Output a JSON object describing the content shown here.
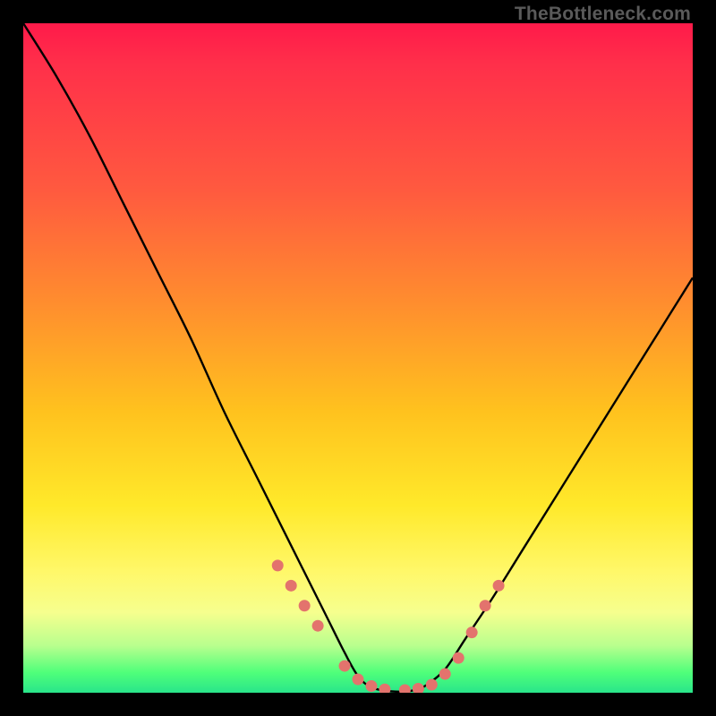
{
  "watermark": "TheBottleneck.com",
  "colors": {
    "frame": "#000000",
    "gradient_top": "#ff1a4a",
    "gradient_mid1": "#ff8e2e",
    "gradient_mid2": "#ffe92a",
    "gradient_bottom": "#29e58a",
    "curve": "#000000",
    "dots": "#e3736d"
  },
  "chart_data": {
    "type": "line",
    "title": "",
    "xlabel": "",
    "ylabel": "",
    "xlim": [
      0,
      100
    ],
    "ylim": [
      0,
      100
    ],
    "grid": false,
    "legend": false,
    "series": [
      {
        "name": "bottleneck-curve",
        "x": [
          0,
          5,
          10,
          15,
          20,
          25,
          30,
          35,
          40,
          45,
          48,
          50,
          52,
          55,
          58,
          60,
          63,
          66,
          70,
          75,
          80,
          85,
          90,
          95,
          100
        ],
        "y": [
          100,
          92,
          83,
          73,
          63,
          53,
          42,
          32,
          22,
          12,
          6,
          2.5,
          0.8,
          0.2,
          0.3,
          1.0,
          3.5,
          8,
          14,
          22,
          30,
          38,
          46,
          54,
          62
        ]
      }
    ],
    "markers": {
      "name": "highlight-dots",
      "x": [
        38,
        40,
        42,
        44,
        48,
        50,
        52,
        54,
        57,
        59,
        61,
        63,
        65,
        67,
        69,
        71
      ],
      "y": [
        19,
        16,
        13,
        10,
        4,
        2,
        1,
        0.5,
        0.4,
        0.6,
        1.2,
        2.8,
        5.2,
        9,
        13,
        16
      ]
    },
    "annotations": [
      {
        "text": "TheBottleneck.com",
        "position": "top-right"
      }
    ]
  }
}
